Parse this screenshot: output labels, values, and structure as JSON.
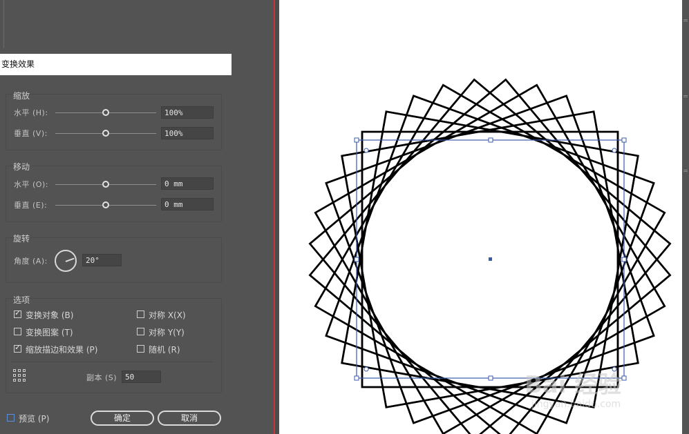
{
  "dialog": {
    "title": "变换效果",
    "scale": {
      "title": "缩放",
      "horizontal_label": "水平 (H):",
      "horizontal_value": "100%",
      "vertical_label": "垂直 (V):",
      "vertical_value": "100%"
    },
    "move": {
      "title": "移动",
      "horizontal_label": "水平 (O):",
      "horizontal_value": "0 mm",
      "vertical_label": "垂直 (E):",
      "vertical_value": "0 mm"
    },
    "rotate": {
      "title": "旋转",
      "angle_label": "角度 (A):",
      "angle_value": "20°"
    },
    "options": {
      "title": "选项",
      "transform_objects": {
        "label": "变换对象 (B)",
        "checked": true
      },
      "transform_patterns": {
        "label": "变换图案 (T)",
        "checked": false
      },
      "scale_strokes": {
        "label": "缩放描边和效果 (P)",
        "checked": true
      },
      "reflect_x": {
        "label": "对称 X(X)",
        "checked": false
      },
      "reflect_y": {
        "label": "对称 Y(Y)",
        "checked": false
      },
      "random": {
        "label": "随机 (R)",
        "checked": false
      }
    },
    "copies_label": "副本 (S)",
    "copies_value": "50",
    "preview_label": "预览 (P)",
    "ok_label": "确定",
    "cancel_label": "取消"
  },
  "artwork": {
    "copies_count": 18,
    "rotation_step_deg": 20,
    "stroke_color": "#000000",
    "selection_color": "#3a5ba8"
  },
  "watermark": {
    "text_logo": "Bai 经验",
    "url": "jingyan.baidu.com"
  }
}
